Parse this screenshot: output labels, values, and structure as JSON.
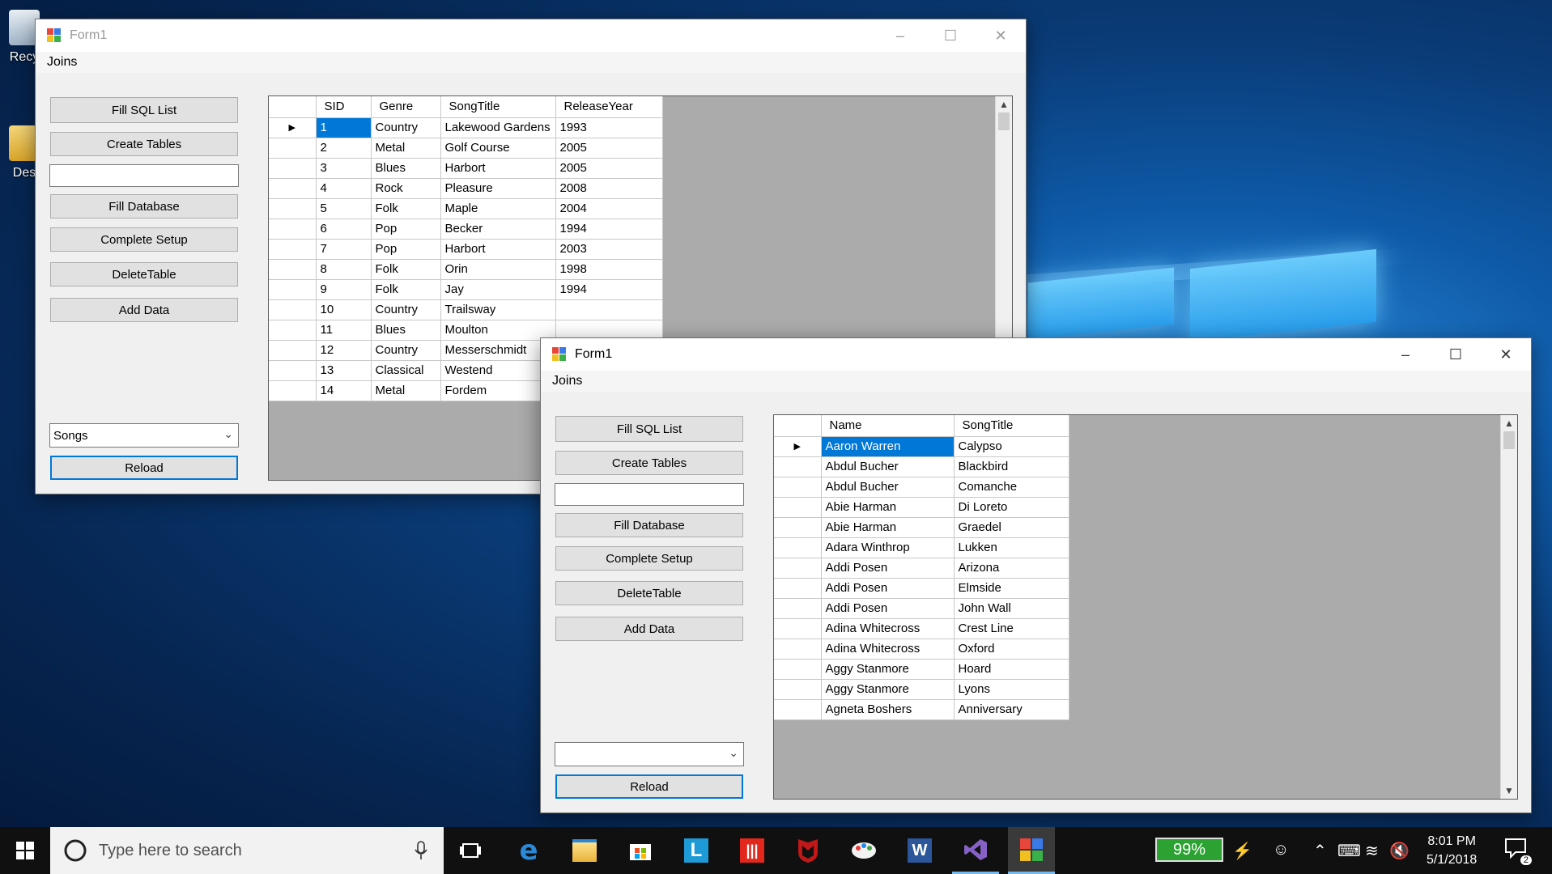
{
  "desktop": {
    "icons": [
      {
        "label": "Recy"
      },
      {
        "label": "Des"
      }
    ]
  },
  "window_back": {
    "title": "Form1",
    "menu": [
      "Joins"
    ],
    "buttons": {
      "fill_sql": "Fill SQL List",
      "create_tables": "Create Tables",
      "fill_database": "Fill Database",
      "complete_setup": "Complete Setup",
      "delete_table": "DeleteTable",
      "add_data": "Add Data",
      "reload": "Reload"
    },
    "textbox_value": "",
    "combo_value": "Songs",
    "grid": {
      "columns": [
        "SID",
        "Genre",
        "SongTitle",
        "ReleaseYear"
      ],
      "rows": [
        [
          "1",
          "Country",
          "Lakewood Gardens",
          "1993"
        ],
        [
          "2",
          "Metal",
          "Golf Course",
          "2005"
        ],
        [
          "3",
          "Blues",
          "Harbort",
          "2005"
        ],
        [
          "4",
          "Rock",
          "Pleasure",
          "2008"
        ],
        [
          "5",
          "Folk",
          "Maple",
          "2004"
        ],
        [
          "6",
          "Pop",
          "Becker",
          "1994"
        ],
        [
          "7",
          "Pop",
          "Harbort",
          "2003"
        ],
        [
          "8",
          "Folk",
          "Orin",
          "1998"
        ],
        [
          "9",
          "Folk",
          "Jay",
          "1994"
        ],
        [
          "10",
          "Country",
          "Trailsway",
          ""
        ],
        [
          "11",
          "Blues",
          "Moulton",
          ""
        ],
        [
          "12",
          "Country",
          "Messerschmidt",
          ""
        ],
        [
          "13",
          "Classical",
          "Westend",
          ""
        ],
        [
          "14",
          "Metal",
          "Fordem",
          ""
        ]
      ]
    }
  },
  "window_front": {
    "title": "Form1",
    "menu": [
      "Joins"
    ],
    "buttons": {
      "fill_sql": "Fill SQL List",
      "create_tables": "Create Tables",
      "fill_database": "Fill Database",
      "complete_setup": "Complete Setup",
      "delete_table": "DeleteTable",
      "add_data": "Add Data",
      "reload": "Reload"
    },
    "textbox_value": "",
    "combo_value": "",
    "grid": {
      "columns": [
        "Name",
        "SongTitle"
      ],
      "rows": [
        [
          "Aaron Warren",
          "Calypso"
        ],
        [
          "Abdul Bucher",
          "Blackbird"
        ],
        [
          "Abdul Bucher",
          "Comanche"
        ],
        [
          "Abie Harman",
          "Di Loreto"
        ],
        [
          "Abie Harman",
          "Graedel"
        ],
        [
          "Adara Winthrop",
          "Lukken"
        ],
        [
          "Addi Posen",
          "Arizona"
        ],
        [
          "Addi Posen",
          "Elmside"
        ],
        [
          "Addi Posen",
          "John Wall"
        ],
        [
          "Adina Whitecross",
          "Crest Line"
        ],
        [
          "Adina Whitecross",
          "Oxford"
        ],
        [
          "Aggy Stanmore",
          "Hoard"
        ],
        [
          "Aggy Stanmore",
          "Lyons"
        ],
        [
          "Agneta Boshers",
          "Anniversary"
        ]
      ]
    }
  },
  "taskbar": {
    "search_placeholder": "Type here to search",
    "battery": "99%",
    "time": "8:01 PM",
    "date": "5/1/2018",
    "notification_count": "2",
    "apps": [
      "task-view-icon",
      "edge-icon",
      "file-explorer-icon",
      "store-icon",
      "lync-icon",
      "office-red-icon",
      "mcafee-icon",
      "paint-icon",
      "word-icon",
      "visual-studio-icon",
      "winforms-app-icon"
    ]
  },
  "colors": {
    "selection": "#0078d7",
    "battery": "#2ba232",
    "grid_background": "#ababab"
  }
}
